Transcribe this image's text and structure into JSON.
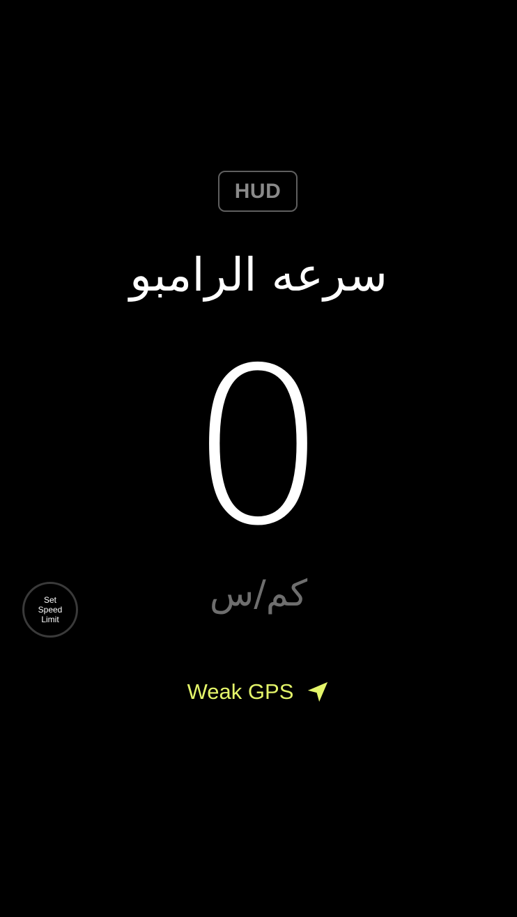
{
  "hud": {
    "label": "HUD"
  },
  "title": {
    "text": "سرعه الرامبو"
  },
  "speed": {
    "value": "0",
    "unit": "كم/س"
  },
  "speed_limit": {
    "label": "Set\nSpeed\nLimit"
  },
  "gps": {
    "status": "Weak GPS",
    "icon": "location-arrow-icon",
    "color": "#e4f56a"
  },
  "colors": {
    "background": "#000000",
    "primary_text": "#ffffff",
    "muted_text": "#6e6e6e"
  }
}
